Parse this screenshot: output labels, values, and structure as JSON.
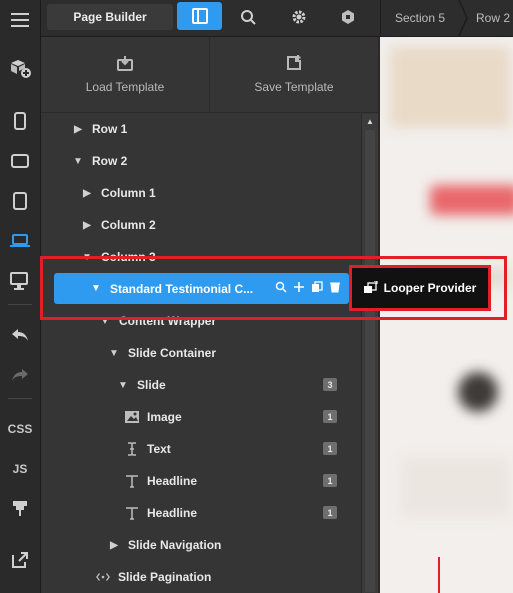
{
  "topbar": {
    "title": "Page Builder",
    "breadcrumbs": [
      "Section 5",
      "Row 2"
    ],
    "icons": [
      "layout-icon",
      "search-icon",
      "gear-icon",
      "hexagon-icon"
    ]
  },
  "toolbar": {
    "items": [
      "menu-icon",
      "element-add-icon",
      "phone-icon",
      "tablet-icon",
      "tablet-portrait-icon",
      "laptop-icon",
      "desktop-icon",
      "undo-icon",
      "redo-icon"
    ],
    "css_label": "CSS",
    "js_label": "JS",
    "active_color": "#2e9bf0"
  },
  "templates": {
    "load_label": "Load Template",
    "save_label": "Save Template"
  },
  "tree": {
    "row1": "Row 1",
    "row2": "Row 2",
    "col1": "Column 1",
    "col2": "Column 2",
    "col3": "Column 3",
    "selected": "Standard Testimonial C...",
    "content_wrapper": "Content Wrapper",
    "slide_container": "Slide Container",
    "slide": "Slide",
    "slide_count": "3",
    "image": "Image",
    "image_count": "1",
    "text": "Text",
    "text_count": "1",
    "headline1": "Headline",
    "headline1_count": "1",
    "headline2": "Headline",
    "headline2_count": "1",
    "slide_navigation": "Slide Navigation",
    "slide_pagination": "Slide Pagination"
  },
  "tooltip": {
    "label": "Looper Provider"
  },
  "colors": {
    "accent": "#2e9bf0",
    "highlight": "#e01f26"
  }
}
